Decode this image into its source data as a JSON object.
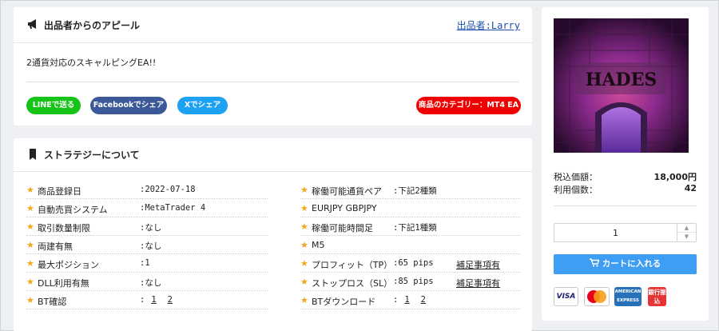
{
  "appeal": {
    "title": "出品者からのアピール",
    "seller_link": "出品者:Larry",
    "text": "2通貨対応のスキャルピングEA!!",
    "buttons": {
      "line": "LINEで送る",
      "facebook": "Facebookでシェア",
      "x": "Xでシェア",
      "category": "商品のカテゴリー：MT4 EA"
    }
  },
  "strategy": {
    "title": "ストラテジーについて",
    "left": [
      {
        "label": "商品登録日",
        "value": ":2022-07-18"
      },
      {
        "label": "自動売買システム",
        "value": ":MetaTrader 4"
      },
      {
        "label": "取引数量制限",
        "value": ":なし"
      },
      {
        "label": "両建有無",
        "value": ":なし"
      },
      {
        "label": "最大ポジション",
        "value": ":1"
      },
      {
        "label": "DLL利用有無",
        "value": ":なし"
      },
      {
        "label": "BT確認",
        "value": ":",
        "links": [
          "1",
          "2"
        ]
      }
    ],
    "right": [
      {
        "label": "稼働可能通貨ペア",
        "value": ":下記2種類"
      },
      {
        "label": "EURJPY GBPJPY",
        "value": ""
      },
      {
        "label": "稼働可能時間足",
        "value": ":下記1種類"
      },
      {
        "label": "M5",
        "value": ""
      },
      {
        "label": "プロフィット（TP）",
        "value": ":65 pips",
        "extra": "補足事項有"
      },
      {
        "label": "ストップロス（SL）",
        "value": ":85 pips",
        "extra": "補足事項有"
      },
      {
        "label": "BTダウンロード",
        "value": ":",
        "links": [
          "1",
          "2"
        ]
      }
    ]
  },
  "purchase": {
    "image_text": "HADES",
    "price_label": "税込価額：",
    "price": "18,000円",
    "usage_label": "利用個数：",
    "usage": "42",
    "quantity": "1",
    "cart_button": "カートに入れる",
    "cards": {
      "visa": "VISA",
      "master": "MasterCard",
      "amex": "AMERICAN EXPRESS",
      "bank": "銀行振込"
    }
  },
  "colors": {
    "star": "#f0a81a",
    "line": "#16c317",
    "facebook": "#3b5998",
    "x": "#1da1f2",
    "category": "#f00000",
    "cart": "#3d9ef3"
  }
}
